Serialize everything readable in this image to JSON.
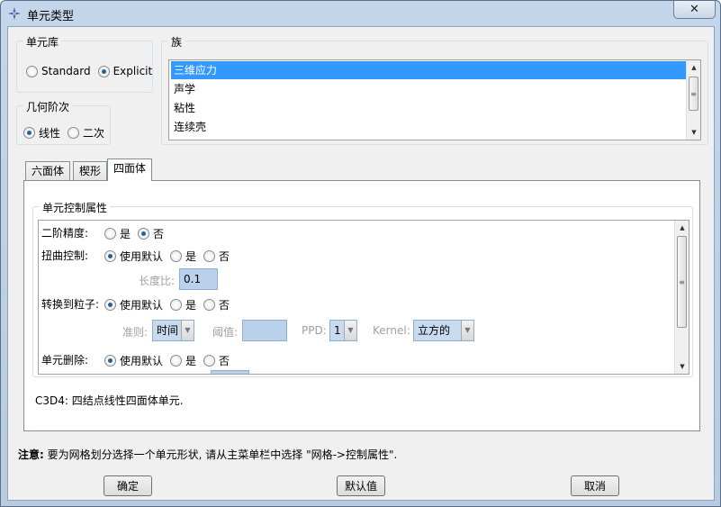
{
  "window": {
    "title": "单元类型",
    "close_symbol": "✕"
  },
  "library": {
    "legend": "单元库",
    "options": [
      {
        "label": "Standard",
        "selected": false
      },
      {
        "label": "Explicit",
        "selected": true
      }
    ]
  },
  "order": {
    "legend": "几何阶次",
    "options": [
      {
        "label": "线性",
        "selected": true
      },
      {
        "label": "二次",
        "selected": false
      }
    ]
  },
  "family": {
    "legend": "族",
    "items": [
      "三维应力",
      "声学",
      "粘性",
      "连续壳"
    ],
    "selected_index": 0
  },
  "tabs": [
    {
      "label": "六面体",
      "active": false
    },
    {
      "label": "楔形",
      "active": false
    },
    {
      "label": "四面体",
      "active": true
    }
  ],
  "controls": {
    "legend": "单元控制属性",
    "second_order_accuracy": {
      "label": "二阶精度:",
      "yes": "是",
      "no": "否",
      "selected": "no"
    },
    "distortion_control": {
      "label": "扭曲控制:",
      "default": "使用默认",
      "yes": "是",
      "no": "否",
      "selected": "default"
    },
    "length_ratio": {
      "label": "长度比:",
      "value": "0.1"
    },
    "convert_to_particles": {
      "label": "转换到粒子:",
      "default": "使用默认",
      "yes": "是",
      "no": "否",
      "selected": "default"
    },
    "criterion": {
      "label": "准则:",
      "value": "时间"
    },
    "threshold": {
      "label": "阈值:",
      "value": ""
    },
    "ppd": {
      "label": "PPD:",
      "value": "1"
    },
    "kernel": {
      "label": "Kernel:",
      "value": "立方的"
    },
    "element_deletion": {
      "label": "单元删除:",
      "default": "使用默认",
      "yes": "是",
      "no": "否",
      "selected": "default"
    }
  },
  "description": "C3D4:  四结点线性四面体单元.",
  "note": {
    "prefix": "注意:",
    "text": "要为网格划分选择一个单元形状, 请从主菜单栏中选择 \"网格->控制属性\"."
  },
  "buttons": {
    "ok": "确定",
    "defaults": "默认值",
    "cancel": "取消"
  }
}
